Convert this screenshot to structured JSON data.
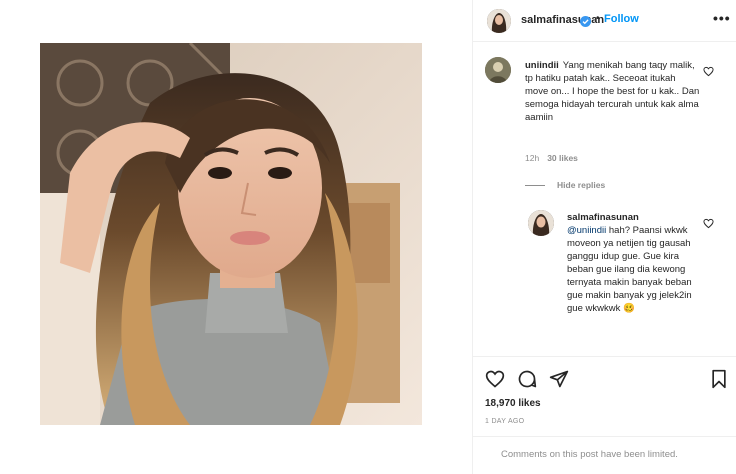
{
  "post": {
    "username": "salmafinasunan",
    "verified": true,
    "dot": "•",
    "follow_label": "Follow",
    "more_label": "•••"
  },
  "comments": [
    {
      "username": "uniindii",
      "text": "Yang menikah bang taqy malik, tp hatiku patah kak.. Seceoat itukah move on... I hope the best for u kak.. Dan semoga hidayah tercurah untuk kak alma aamiin",
      "age": "12h",
      "likes": "30 likes",
      "hide_replies_label": "Hide replies",
      "reply": {
        "username": "salmafinasunan",
        "mention": "@uniindii",
        "text": "hah? Paansi wkwk moveon ya netijen tig gausah ganggu idup gue. Gue kira beban gue ilang dia kewong ternyata makin banyak beban gue makin banyak yg jelek2in gue wkwkwk 🥴"
      }
    }
  ],
  "actions": {
    "likes": "18,970 likes",
    "time": "1 DAY AGO",
    "comments_limited": "Comments on this post have been limited."
  },
  "icons": [
    "verified-badge-icon",
    "more-options-icon",
    "heart-icon",
    "comment-icon",
    "share-icon",
    "bookmark-icon"
  ],
  "colors": {
    "link": "#0095f6",
    "text": "#262626",
    "muted": "#8e8e8e",
    "border": "#efefef"
  }
}
